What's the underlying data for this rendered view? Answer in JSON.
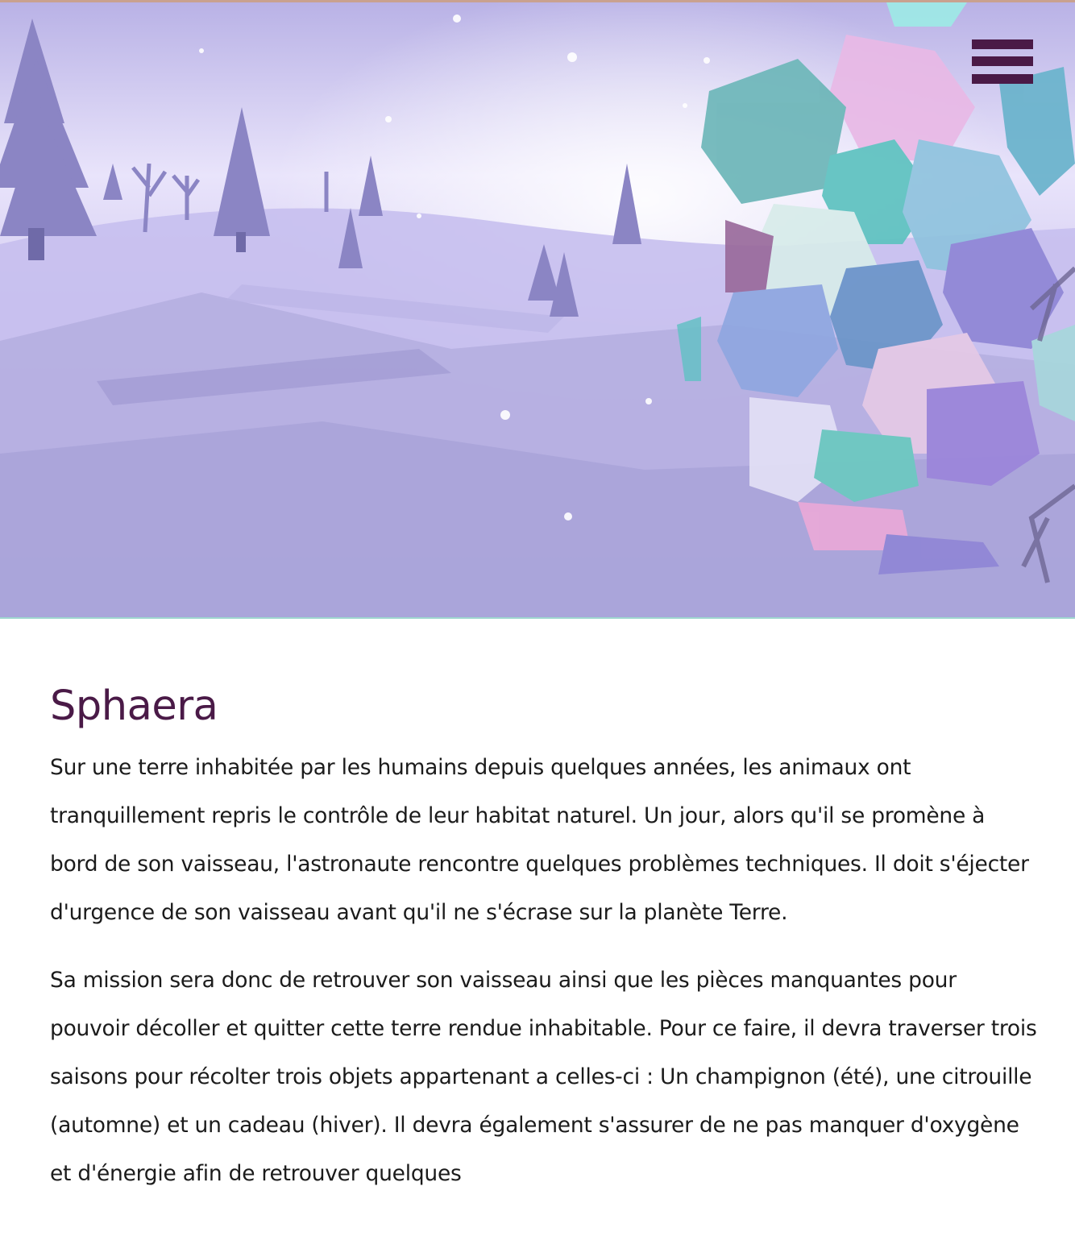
{
  "hero": {
    "image_icon": "crystal-sphere-winter-landscape-illustration"
  },
  "nav": {
    "menu_icon": "hamburger-menu-icon",
    "menu_color": "#4a1a47"
  },
  "article": {
    "title": "Sphaera",
    "title_color": "#4a1a47",
    "paragraphs": [
      "Sur une terre inhabitée par les humains depuis quelques années, les animaux ont tranquillement repris le contrôle de leur habitat naturel. Un jour, alors qu'il se promène à bord de son vaisseau, l'astronaute rencontre quelques problèmes techniques. Il doit s'éjecter d'urgence de son vaisseau avant qu'il ne s'écrase sur la planète Terre.",
      "Sa mission sera donc de retrouver son vaisseau ainsi que les pièces manquantes pour pouvoir décoller et quitter cette terre rendue inhabitable. Pour ce faire, il devra traverser trois saisons pour récolter trois objets appartenant a celles-ci : Un champignon (été), une citrouille (automne) et un cadeau (hiver). Il devra également s'assurer de ne pas manquer d'oxygène et d'énergie afin de retrouver quelques"
    ]
  }
}
